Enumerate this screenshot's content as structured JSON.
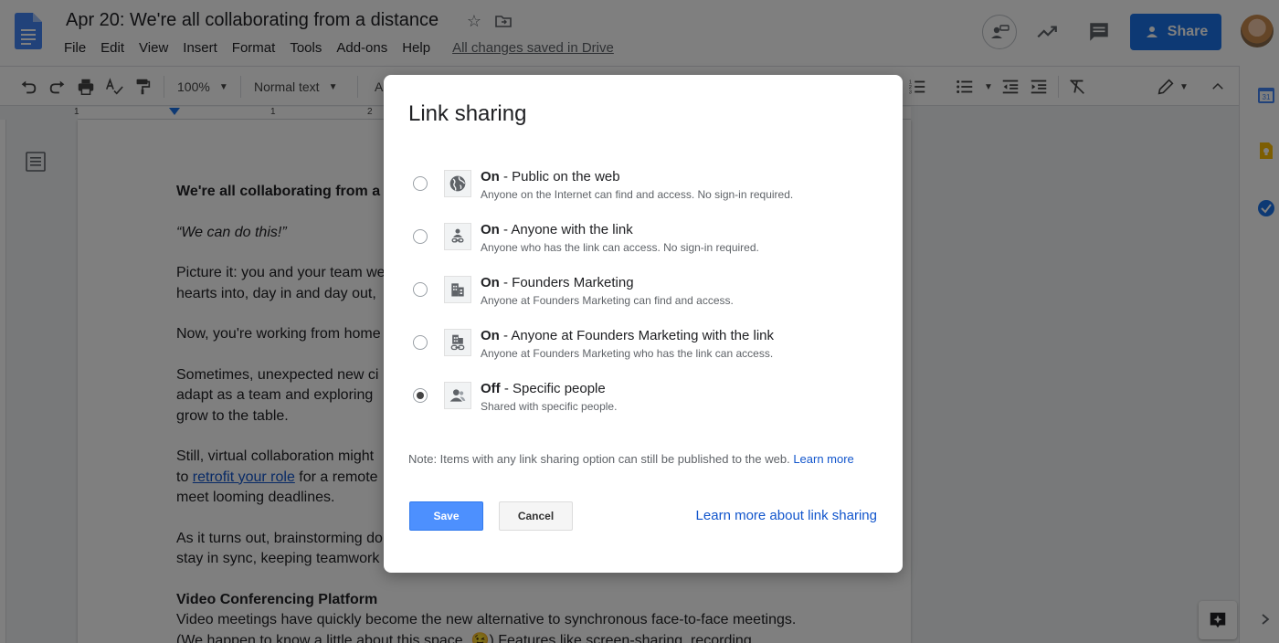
{
  "header": {
    "title": "Apr 20: We're all collaborating from a distance",
    "menu": [
      "File",
      "Edit",
      "View",
      "Insert",
      "Format",
      "Tools",
      "Add-ons",
      "Help"
    ],
    "saved_status": "All changes saved in Drive",
    "share_label": "Share"
  },
  "toolbar": {
    "zoom": "100%",
    "style": "Normal text",
    "font_partial": "Ar"
  },
  "ruler": {
    "numbers": [
      "1",
      "1",
      "2"
    ]
  },
  "document": {
    "heading_partial": "We're all collaborating from a",
    "quote": "“We can do this!”",
    "p1_line1": "Picture it: you and your team we",
    "p1_line2": "hearts into, day in and day out,",
    "p2_line1": "Now, you're working from home",
    "p3_line1": "Sometimes, unexpected new ci",
    "p3_line2": "adapt as a team and exploring",
    "p3_line3": "grow to the table.",
    "p4_line1": "Still, virtual collaboration might",
    "p4_line2_pre": "to ",
    "p4_link": "retrofit your role",
    "p4_line2_post": " for a remote",
    "p4_line3": "meet looming deadlines.",
    "p5_line1": "As it turns out, brainstorming do",
    "p5_line2": "stay in sync, keeping teamwork",
    "section_heading": "Video Conferencing Platform",
    "section_line1": "Video meetings have quickly become the new alternative to synchronous face-to-face meetings.",
    "section_line2": "(We happen to know a little about this space. 😉) Features like screen-sharing, recording"
  },
  "dialog": {
    "title": "Link sharing",
    "options": [
      {
        "state": "On",
        "label": " - Public on the web",
        "desc": "Anyone on the Internet can find and access. No sign-in required.",
        "icon": "globe-icon",
        "checked": false
      },
      {
        "state": "On",
        "label": " - Anyone with the link",
        "desc": "Anyone who has the link can access. No sign-in required.",
        "icon": "person-link-icon",
        "checked": false
      },
      {
        "state": "On",
        "label": " - Founders Marketing",
        "desc": "Anyone at Founders Marketing can find and access.",
        "icon": "building-icon",
        "checked": false
      },
      {
        "state": "On",
        "label": " - Anyone at Founders Marketing with the link",
        "desc": "Anyone at Founders Marketing who has the link can access.",
        "icon": "building-link-icon",
        "checked": false
      },
      {
        "state": "Off",
        "label": " - Specific people",
        "desc": "Shared with specific people.",
        "icon": "person-icon",
        "checked": true
      }
    ],
    "note": "Note: Items with any link sharing option can still be published to the web.",
    "note_link": "Learn more",
    "save_label": "Save",
    "cancel_label": "Cancel",
    "learn_more_label": "Learn more about link sharing"
  },
  "side_panel": {
    "calendar_day": "31"
  },
  "colors": {
    "accent": "#1a73e8",
    "save_button": "#4d90fe",
    "link": "#1155cc"
  }
}
